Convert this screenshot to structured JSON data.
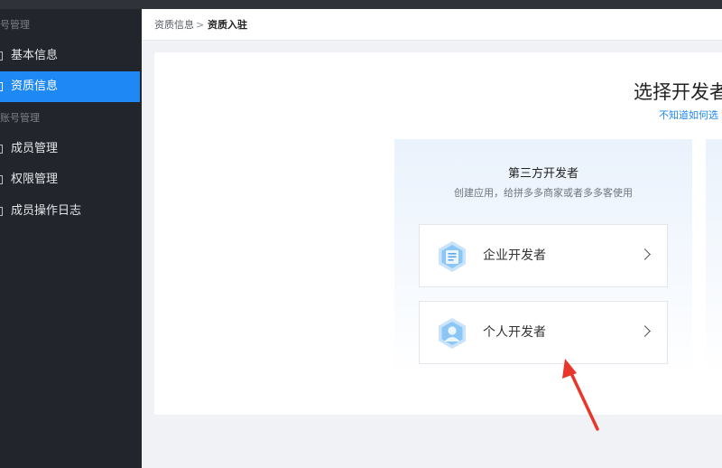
{
  "sidebar": {
    "group_account": "号管理",
    "item_basic": "基本信息",
    "item_qualification": "资质信息",
    "group_sub_account": "账号管理",
    "item_members": "成员管理",
    "item_permissions": "权限管理",
    "item_member_log": "成员操作日志"
  },
  "breadcrumb": {
    "parent": "资质信息",
    "separator": ">",
    "current": "资质入驻"
  },
  "main": {
    "heading": "选择开发者",
    "help_link": "不知道如何选"
  },
  "panel": {
    "title": "第三方开发者",
    "subtitle": "创建应用，给拼多多商家或者多多客使用",
    "option_enterprise": "企业开发者",
    "option_individual": "个人开发者"
  },
  "colors": {
    "accent": "#1e88f5",
    "sidebar_bg": "#22252b",
    "annotation_arrow": "#e8362b"
  },
  "icons": {
    "enterprise": "document-shield-icon",
    "individual": "person-shield-icon",
    "chevron": "chevron-right-icon"
  }
}
